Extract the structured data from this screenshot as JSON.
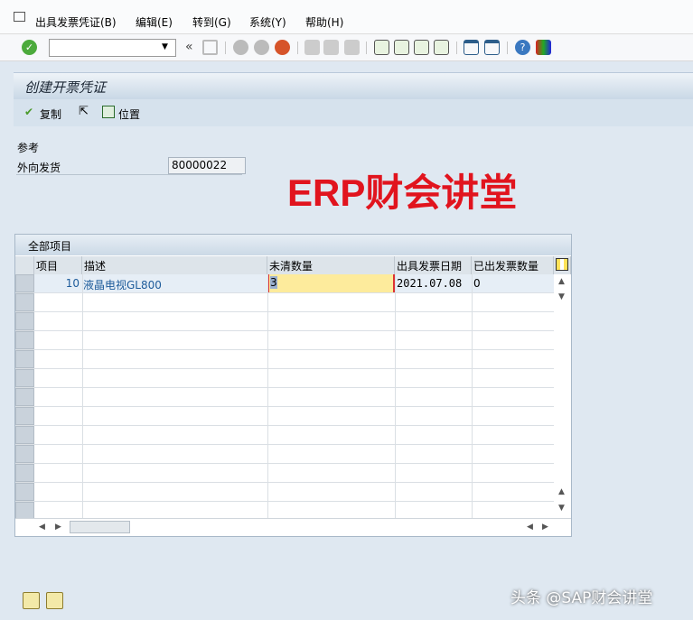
{
  "menu": {
    "items": [
      "出具发票凭证(B)",
      "编辑(E)",
      "转到(G)",
      "系统(Y)",
      "帮助(H)"
    ]
  },
  "toolbar": {
    "command_value": ""
  },
  "page": {
    "title": "创建开票凭证"
  },
  "app_toolbar": {
    "copy": "复制",
    "position": "位置"
  },
  "form": {
    "section": "参考",
    "field_label": "外向发货",
    "field_value": "80000022"
  },
  "watermark": "ERP财会讲堂",
  "table": {
    "title": "全部项目",
    "columns": [
      "项目",
      "描述",
      "未清数量",
      "出具发票日期",
      "已出发票数量"
    ],
    "rows": [
      {
        "item": "10",
        "desc": "液晶电视GL800",
        "open_qty": "3",
        "date": "2021.07.08",
        "billed_qty": "0"
      }
    ]
  },
  "footer": "头条 @SAP财会讲堂"
}
